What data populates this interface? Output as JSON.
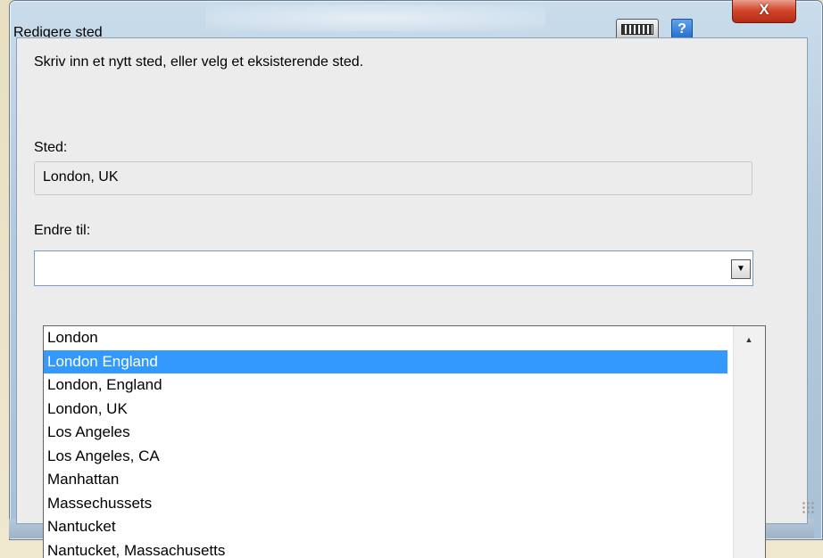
{
  "window": {
    "title": "Redigere sted",
    "help_label": "?",
    "close_label": "X"
  },
  "dialog": {
    "instruction": "Skriv inn et nytt sted, eller velg et eksisterende sted.",
    "sted_label": "Sted:",
    "sted_value": "London, UK",
    "endre_label": "Endre til:",
    "endre_value": ""
  },
  "dropdown": {
    "items": [
      {
        "label": "London",
        "selected": false
      },
      {
        "label": "London England",
        "selected": true
      },
      {
        "label": "London, England",
        "selected": false
      },
      {
        "label": "London, UK",
        "selected": false
      },
      {
        "label": "Los Angeles",
        "selected": false
      },
      {
        "label": "Los Angeles, CA",
        "selected": false
      },
      {
        "label": "Manhattan",
        "selected": false
      },
      {
        "label": "Massechussets",
        "selected": false
      },
      {
        "label": "Nantucket",
        "selected": false
      },
      {
        "label": "Nantucket, Massachusetts",
        "selected": false
      }
    ],
    "selected_color": "#3399ff"
  },
  "icons": {
    "keyboard": "keyboard-icon",
    "help": "help-icon",
    "close": "close-icon",
    "dropdown": "chevron-down-icon",
    "scroll_up": "scroll-up-icon"
  }
}
